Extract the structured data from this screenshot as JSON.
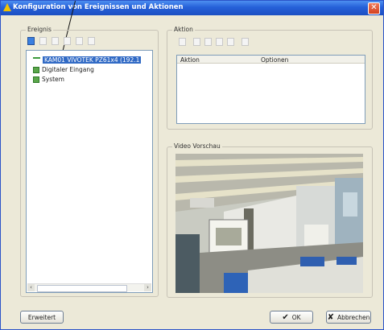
{
  "window": {
    "title": "Konfiguration von Ereignissen und Aktionen"
  },
  "ereignis": {
    "label": "Ereignis",
    "tree": [
      {
        "label": "KAM01 VIVOTEK PZ61x4 (192.1",
        "selected": true,
        "icon": "camera-icon"
      },
      {
        "label": "Digitaler Eingang",
        "selected": false,
        "icon": "input-node-icon"
      },
      {
        "label": "System",
        "selected": false,
        "icon": "system-node-icon"
      }
    ]
  },
  "aktion": {
    "label": "Aktion",
    "columns": [
      "Aktion",
      "Optionen"
    ]
  },
  "video": {
    "label": "Video Vorschau"
  },
  "buttons": {
    "erweitert": "Erweitert",
    "ok": "OK",
    "abbrechen": "Abbrechen"
  },
  "colors": {
    "titlebar": "#2560d8",
    "selection": "#316ac5",
    "dialog_bg": "#ece9d8"
  }
}
